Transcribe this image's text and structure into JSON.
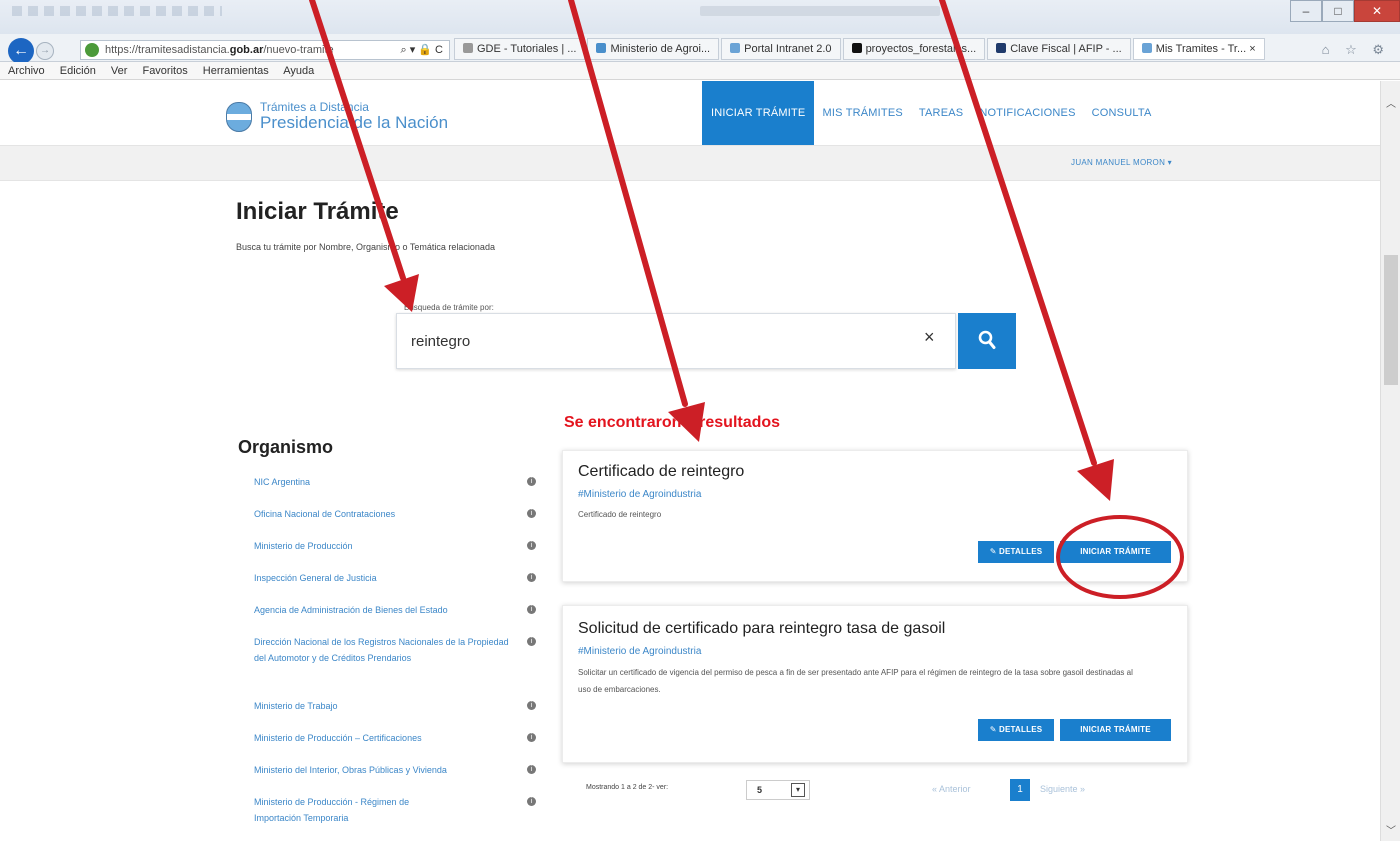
{
  "browser": {
    "url_prefix": "https://tramitesadistancia.",
    "url_domain": "gob.ar",
    "url_path": "/nuevo-tramite",
    "addr_actions": "⌕ ▾ 🔒 C",
    "tabs": [
      {
        "label": "GDE - Tutoriales | ..."
      },
      {
        "label": "Ministerio de Agroi..."
      },
      {
        "label": "Portal Intranet 2.0"
      },
      {
        "label": "proyectos_forestales..."
      },
      {
        "label": "Clave Fiscal | AFIP - ..."
      },
      {
        "label": "Mis Tramites - Tr... ×"
      }
    ],
    "menu": [
      "Archivo",
      "Edición",
      "Ver",
      "Favoritos",
      "Herramientas",
      "Ayuda"
    ],
    "right_icons": "⌂ ☆ ⚙"
  },
  "header": {
    "logo_line1": "Trámites a Distancia",
    "logo_line2": "Presidencia de la Nación",
    "nav": [
      {
        "label": "INICIAR TRÁMITE",
        "active": true
      },
      {
        "label": "MIS TRÁMITES"
      },
      {
        "label": "TAREAS"
      },
      {
        "label": "NOTIFICACIONES"
      },
      {
        "label": "CONSULTA"
      }
    ],
    "user": "JUAN MANUEL MORON ▾"
  },
  "page": {
    "title": "Iniciar Trámite",
    "subtitle": "Busca tu trámite por Nombre, Organismo o Temática relacionada"
  },
  "search": {
    "label": "Búsqueda de trámite por:",
    "value": "reintegro",
    "clear": "×"
  },
  "results": {
    "title": "Se encontraron 2 resultados",
    "items": [
      {
        "title": "Certificado de reintegro",
        "org": "#Ministerio de Agroindustria",
        "desc": "Certificado de reintegro",
        "details": "✎ DETALLES",
        "start": "INICIAR TRÁMITE"
      },
      {
        "title": "Solicitud de certificado para reintegro tasa de gasoil",
        "org": "#Ministerio de Agroindustria",
        "desc": "Solicitar un certificado de vigencia del permiso de pesca a fin de ser presentado ante AFIP para el régimen de reintegro de la tasa sobre gasoil destinadas al uso de embarcaciones.",
        "details": "✎ DETALLES",
        "start": "INICIAR TRÁMITE"
      }
    ]
  },
  "organismo": {
    "title": "Organismo",
    "items": [
      "NIC Argentina",
      "Oficina Nacional de Contrataciones",
      "Ministerio de Producción",
      "Inspección General de Justicia",
      "Agencia de Administración de Bienes del Estado",
      "Dirección Nacional de los Registros Nacionales de la Propiedad del Automotor y de Créditos Prendarios",
      "Ministerio de Trabajo",
      "Ministerio de Producción – Certificaciones",
      "Ministerio del Interior, Obras Públicas y Vivienda",
      "Ministerio de Producción - Régimen de Importación Temporaria"
    ]
  },
  "pager": {
    "showing": "Mostrando 1 a 2 de 2- ver:",
    "per_page": "5",
    "prev": "« Anterior",
    "page": "1",
    "next": "Siguiente »"
  },
  "colors": {
    "primary": "#1a7fcd",
    "alert": "#e3141e",
    "annotation": "#cc1f26"
  },
  "icons": {
    "search": "search-icon",
    "info": "info-icon",
    "back": "back-arrow-icon"
  }
}
